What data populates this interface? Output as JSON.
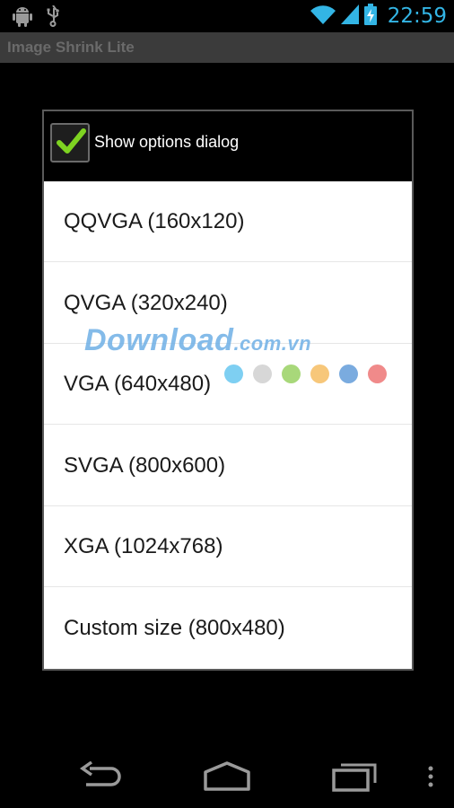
{
  "status_bar": {
    "time": "22:59",
    "icons": [
      "android-debug-icon",
      "usb-icon",
      "wifi-icon",
      "cell-signal-icon",
      "battery-charging-icon"
    ],
    "accent_color": "#33b5e5"
  },
  "app": {
    "title": "Image Shrink Lite"
  },
  "dialog": {
    "checkbox_label": "Show options dialog",
    "checkbox_checked": true,
    "options": [
      {
        "label": "QQVGA (160x120)"
      },
      {
        "label": "QVGA (320x240)"
      },
      {
        "label": "VGA (640x480)"
      },
      {
        "label": "SVGA (800x600)"
      },
      {
        "label": "XGA (1024x768)"
      },
      {
        "label": "Custom size (800x480)"
      }
    ]
  },
  "watermark": {
    "text": "Download",
    "suffix": ".com.vn",
    "dot_colors": [
      "#7ecff2",
      "#d7d7d7",
      "#a8d87a",
      "#f7c77a",
      "#7aabdf",
      "#f08a8a"
    ]
  },
  "nav_bar": {
    "buttons": [
      "back-icon",
      "home-icon",
      "recents-icon",
      "overflow-menu-icon"
    ]
  }
}
